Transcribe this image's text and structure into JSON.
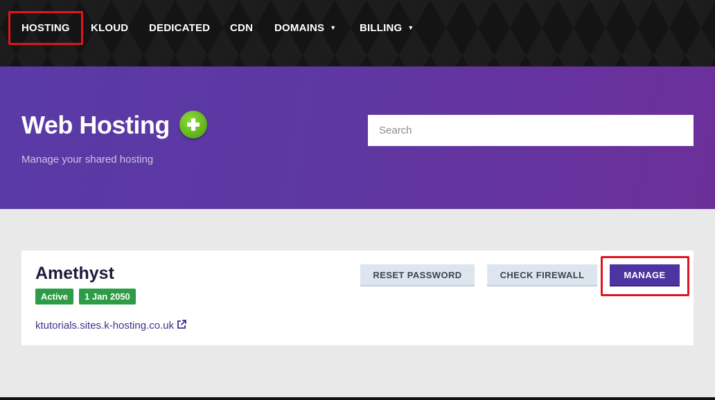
{
  "nav": {
    "items": [
      {
        "label": "HOSTING",
        "active": true
      },
      {
        "label": "KLOUD"
      },
      {
        "label": "DEDICATED"
      },
      {
        "label": "CDN"
      },
      {
        "label": "DOMAINS",
        "dropdown": true
      },
      {
        "label": "BILLING",
        "dropdown": true
      }
    ],
    "caret": "▼"
  },
  "hero": {
    "title": "Web Hosting",
    "subtitle": "Manage your shared hosting",
    "add_icon": "plus-circle-icon",
    "search_placeholder": "Search"
  },
  "card": {
    "title": "Amethyst",
    "status_badge": "Active",
    "date_badge": "1 Jan 2050",
    "link": "ktutorials.sites.k-hosting.co.uk",
    "link_icon": "external-link-icon",
    "buttons": {
      "reset_password": "RESET PASSWORD",
      "check_firewall": "CHECK FIREWALL",
      "manage": "MANAGE"
    }
  },
  "colors": {
    "accent_purple": "#4d34a0",
    "badge_green": "#2e9b46",
    "highlight_red": "#e0141c",
    "add_green": "#5fb31b"
  }
}
